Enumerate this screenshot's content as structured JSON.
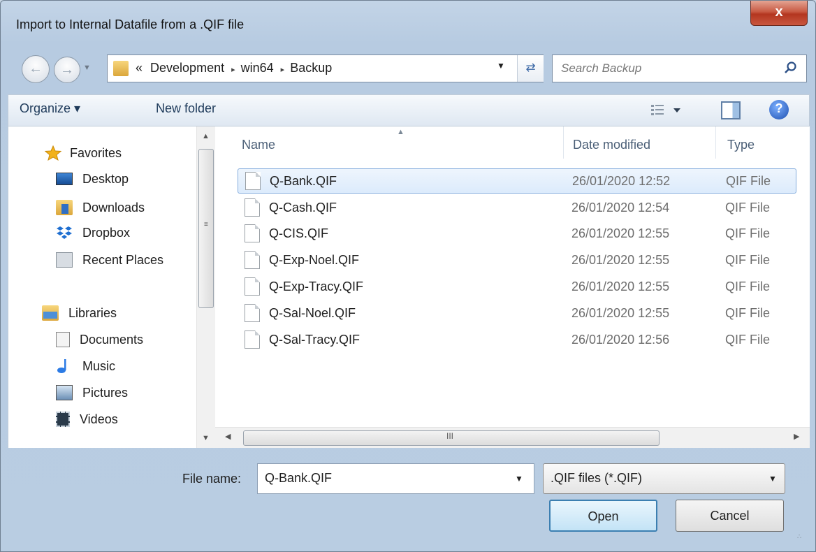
{
  "window": {
    "title": "Import to Internal Datafile from a .QIF file",
    "close_label": "x"
  },
  "address_bar": {
    "overflow": "«",
    "crumbs": [
      "Development",
      "win64",
      "Backup"
    ],
    "separator": "▸"
  },
  "search": {
    "placeholder": "Search Backup"
  },
  "toolbar": {
    "organize_label": "Organize ▾",
    "new_folder_label": "New folder"
  },
  "nav_pane": {
    "favorites": {
      "label": "Favorites",
      "items": [
        "Desktop",
        "Downloads",
        "Dropbox",
        "Recent Places"
      ]
    },
    "libraries": {
      "label": "Libraries",
      "items": [
        "Documents",
        "Music",
        "Pictures",
        "Videos"
      ]
    }
  },
  "columns": {
    "name": "Name",
    "date": "Date modified",
    "type": "Type"
  },
  "files": [
    {
      "name": "Q-Bank.QIF",
      "date": "26/01/2020 12:52",
      "type": "QIF File",
      "selected": true
    },
    {
      "name": "Q-Cash.QIF",
      "date": "26/01/2020 12:54",
      "type": "QIF File"
    },
    {
      "name": "Q-CIS.QIF",
      "date": "26/01/2020 12:55",
      "type": "QIF File"
    },
    {
      "name": "Q-Exp-Noel.QIF",
      "date": "26/01/2020 12:55",
      "type": "QIF File"
    },
    {
      "name": "Q-Exp-Tracy.QIF",
      "date": "26/01/2020 12:55",
      "type": "QIF File"
    },
    {
      "name": "Q-Sal-Noel.QIF",
      "date": "26/01/2020 12:55",
      "type": "QIF File"
    },
    {
      "name": "Q-Sal-Tracy.QIF",
      "date": "26/01/2020 12:56",
      "type": "QIF File"
    }
  ],
  "bottom": {
    "file_name_label": "File name:",
    "file_name_value": "Q-Bank.QIF",
    "filter_value": ".QIF files (*.QIF)",
    "open_label": "Open",
    "cancel_label": "Cancel"
  },
  "scrollbar": {
    "grip": "III"
  },
  "colors": {
    "selection": "#dcebfc",
    "close": "#c85a43",
    "accent": "#3c7fb1"
  }
}
